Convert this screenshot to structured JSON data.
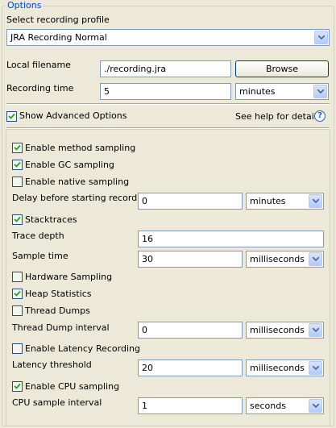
{
  "group": {
    "title": "Options"
  },
  "profile": {
    "label": "Select recording profile",
    "value": "JRA Recording Normal"
  },
  "filename": {
    "label": "Local filename",
    "value": "./recording.jra",
    "browse_label": "Browse"
  },
  "recording_time": {
    "label": "Recording time",
    "value": "5",
    "unit": "minutes"
  },
  "advanced": {
    "label": "Show Advanced Options",
    "checked": true,
    "help_text": "See help for details",
    "help_glyph": "?"
  },
  "method_sampling": {
    "label": "Enable method sampling",
    "checked": true
  },
  "gc_sampling": {
    "label": "Enable GC sampling",
    "checked": true
  },
  "native_sampling": {
    "label": "Enable native sampling",
    "checked": false
  },
  "delay": {
    "label": "Delay before starting recording",
    "value": "0",
    "unit": "minutes"
  },
  "stacktraces": {
    "label": "Stacktraces",
    "checked": true
  },
  "trace_depth": {
    "label": "Trace depth",
    "value": "16"
  },
  "sample_time": {
    "label": "Sample time",
    "value": "30",
    "unit": "milliseconds"
  },
  "hardware_sampling": {
    "label": "Hardware Sampling",
    "checked": false
  },
  "heap_statistics": {
    "label": "Heap Statistics",
    "checked": true
  },
  "thread_dumps": {
    "label": "Thread Dumps",
    "checked": false
  },
  "thread_dump_interval": {
    "label": "Thread Dump interval",
    "value": "0",
    "unit": "milliseconds"
  },
  "latency_recording": {
    "label": "Enable Latency Recording",
    "checked": false
  },
  "latency_threshold": {
    "label": "Latency threshold",
    "value": "20",
    "unit": "milliseconds"
  },
  "cpu_sampling": {
    "label": "Enable CPU sampling",
    "checked": true
  },
  "cpu_interval": {
    "label": "CPU sample interval",
    "value": "1",
    "unit": "seconds"
  }
}
